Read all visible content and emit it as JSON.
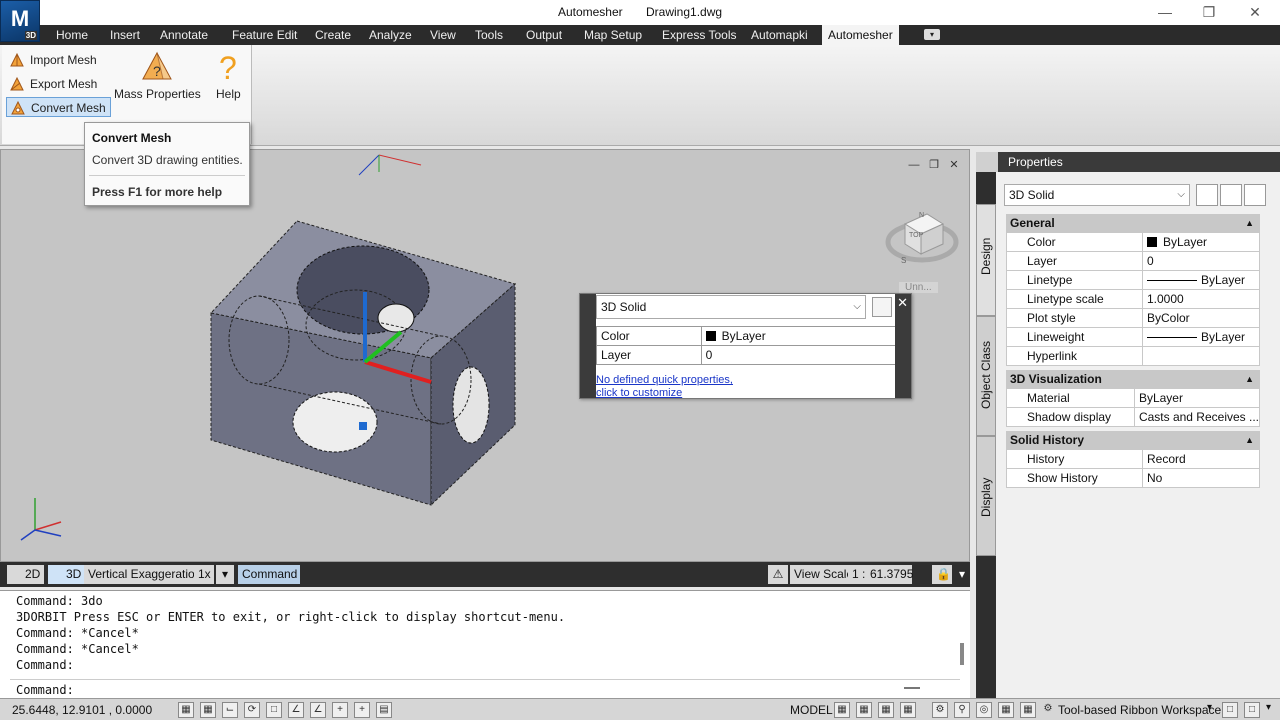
{
  "window": {
    "app_name": "Automesher",
    "document": "Drawing1.dwg",
    "logo_text": "M",
    "logo_badge": "3D"
  },
  "tabs": [
    "Home",
    "Insert",
    "Annotate",
    "Feature Edit",
    "Create",
    "Analyze",
    "View",
    "Tools",
    "Output",
    "Map Setup",
    "Express Tools",
    "Automapki",
    "Automesher"
  ],
  "active_tab": "Automesher",
  "ribbon": {
    "import_mesh": "Import Mesh",
    "export_mesh": "Export Mesh",
    "convert_mesh": "Convert Mesh",
    "mass_properties": "Mass Properties",
    "help": "Help"
  },
  "tooltip": {
    "title": "Convert Mesh",
    "description": "Convert 3D drawing entities.",
    "help_hint": "Press F1 for more help"
  },
  "viewcube": {
    "face": "TOP",
    "north": "N",
    "south": "S",
    "ucs_menu": "Unn..."
  },
  "quick_properties": {
    "object_type": "3D Solid",
    "rows": [
      {
        "label": "Color",
        "value": "ByLayer"
      },
      {
        "label": "Layer",
        "value": "0"
      }
    ],
    "link_line1": "No defined quick properties,",
    "link_line2": "click to customize"
  },
  "viewport_bar": {
    "mode_2d": "2D",
    "mode_3d": "3D",
    "vertical_exaggeration_label": "Vertical Exaggeration:",
    "vertical_exaggeration_value": "1x",
    "command_label": "Command",
    "view_scale_label": "View Scale",
    "view_scale_ratio": "1 :",
    "view_scale_value": "61.3795"
  },
  "command_history": [
    "Command: 3do",
    "3DORBIT Press ESC or ENTER to exit, or right-click to display shortcut-menu.",
    "Command: *Cancel*",
    "Command: *Cancel*",
    "Command:"
  ],
  "command_prompt": "Command:",
  "status_bar": {
    "coordinates": "25.6448, 12.9101 , 0.0000",
    "model": "MODEL",
    "workspace": "Tool-based Ribbon Workspace"
  },
  "properties": {
    "title": "Properties",
    "selected": "3D Solid",
    "side_tabs": [
      "Design",
      "Object Class",
      "Display"
    ],
    "sections": [
      {
        "name": "General",
        "rows": [
          {
            "label": "Color",
            "value": "ByLayer",
            "kind": "swatch"
          },
          {
            "label": "Layer",
            "value": "0"
          },
          {
            "label": "Linetype",
            "value": "ByLayer",
            "kind": "line"
          },
          {
            "label": "Linetype scale",
            "value": "1.0000"
          },
          {
            "label": "Plot style",
            "value": "ByColor"
          },
          {
            "label": "Lineweight",
            "value": "ByLayer",
            "kind": "line"
          },
          {
            "label": "Hyperlink",
            "value": ""
          }
        ]
      },
      {
        "name": "3D Visualization",
        "rows": [
          {
            "label": "Material",
            "value": "ByLayer"
          },
          {
            "label": "Shadow display",
            "value": "Casts and Receives ..."
          }
        ]
      },
      {
        "name": "Solid History",
        "rows": [
          {
            "label": "History",
            "value": "Record"
          },
          {
            "label": "Show History",
            "value": "No"
          }
        ]
      }
    ]
  },
  "colors": {
    "tab_bar": "#2b2b2b",
    "canvas": "#c5c5c5",
    "solid_face": "#7a7d8e",
    "accent": "#1a36c8"
  }
}
